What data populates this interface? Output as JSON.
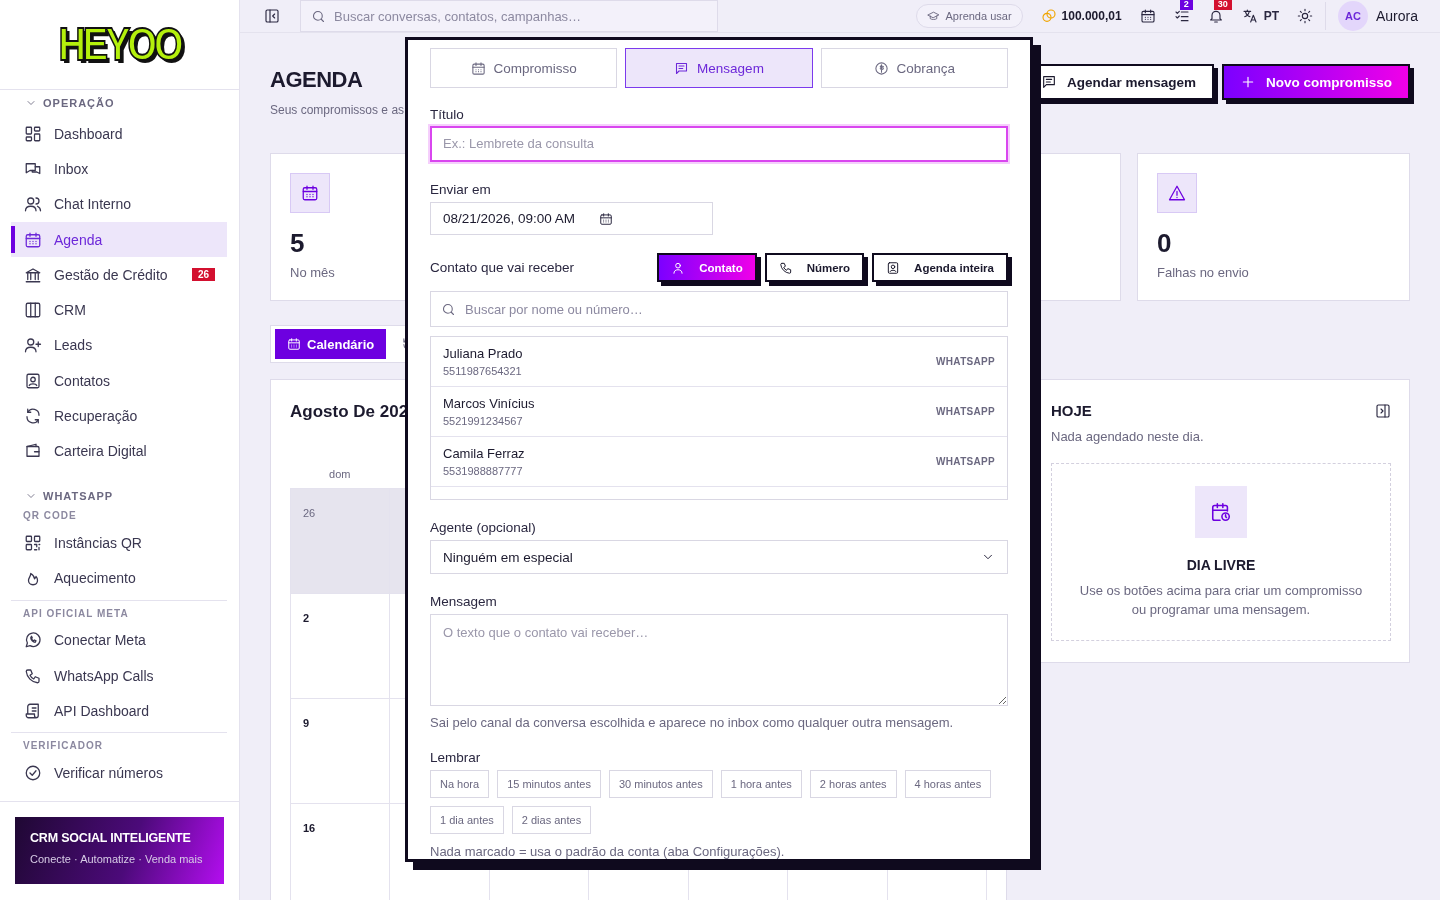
{
  "sidebar": {
    "logo": "HEYOO",
    "groups": [
      {
        "kind": "section",
        "title": "OPERAÇÃO",
        "expanded": true,
        "items": [
          {
            "label": "Dashboard",
            "selected": false
          },
          {
            "label": "Inbox",
            "selected": false
          },
          {
            "label": "Chat Interno",
            "selected": false
          },
          {
            "label": "Agenda",
            "selected": true
          },
          {
            "label": "Gestão de Crédito",
            "selected": false,
            "badge": "26"
          },
          {
            "label": "CRM",
            "selected": false
          },
          {
            "label": "Leads",
            "selected": false
          },
          {
            "label": "Contatos",
            "selected": false
          },
          {
            "label": "Recuperação",
            "selected": false
          },
          {
            "label": "Carteira Digital",
            "selected": false
          }
        ]
      },
      {
        "kind": "section",
        "title": "WHATSAPP",
        "expanded": true
      },
      {
        "kind": "subsection",
        "title": "QR CODE",
        "items": [
          {
            "label": "Instâncias QR",
            "selected": false
          },
          {
            "label": "Aquecimento",
            "selected": false
          }
        ]
      },
      {
        "kind": "subsection",
        "title": "API OFICIAL META",
        "items": [
          {
            "label": "Conectar Meta",
            "selected": false
          },
          {
            "label": "WhatsApp Calls",
            "selected": false
          },
          {
            "label": "API Dashboard",
            "selected": false
          }
        ]
      },
      {
        "kind": "subsection",
        "title": "VERIFICADOR",
        "items": [
          {
            "label": "Verificar números",
            "selected": false
          }
        ]
      }
    ],
    "promo": {
      "title": "CRM SOCIAL INTELIGENTE",
      "subtitle": "Conecte · Automatize · Venda mais"
    }
  },
  "topbar": {
    "search_placeholder": "Buscar conversas, contatos, campanhas…",
    "help_label": "Aprenda usar",
    "credits": "100.000,01",
    "tasks_badge": "2",
    "notifications_badge": "30",
    "language": "PT",
    "user": {
      "initials": "AC",
      "name": "Aurora"
    }
  },
  "page": {
    "title": "AGENDA",
    "subtitle": "Seus compromissos e as",
    "actions": [
      {
        "label": "Agendar mensagem",
        "kind": "secondary"
      },
      {
        "label": "Novo compromisso",
        "kind": "primary"
      }
    ]
  },
  "stats": [
    {
      "value": "5",
      "label": "No mês"
    },
    {
      "value": "0",
      "label": "Falhas no envio"
    }
  ],
  "view_tabs": [
    {
      "label": "Calendário",
      "selected": true
    }
  ],
  "calendar": {
    "title": "Agosto De 202",
    "weekdays": [
      "dom"
    ],
    "weeks": [
      {
        "day": "26",
        "outside": true
      },
      {
        "day": "2",
        "outside": false
      },
      {
        "day": "9",
        "outside": false
      },
      {
        "day": "16",
        "outside": false
      }
    ]
  },
  "today_panel": {
    "title": "HOJE",
    "subtitle": "Nada agendado neste dia.",
    "empty_title": "DIA LIVRE",
    "empty_text": "Use os botões acima para criar um compromisso ou programar uma mensagem."
  },
  "modal": {
    "types": [
      {
        "label": "Compromisso",
        "selected": false
      },
      {
        "label": "Mensagem",
        "selected": true
      },
      {
        "label": "Cobrança",
        "selected": false
      }
    ],
    "title_field": {
      "label": "Título",
      "placeholder": "Ex.: Lembrete da consulta"
    },
    "send_at": {
      "label": "Enviar em",
      "value": "08/21/2026, 09:00 AM"
    },
    "recipient": {
      "label": "Contato que vai receber",
      "modes": [
        {
          "label": "Contato",
          "selected": true
        },
        {
          "label": "Número",
          "selected": false
        },
        {
          "label": "Agenda inteira",
          "selected": false
        }
      ],
      "search_placeholder": "Buscar por nome ou número…",
      "contacts": [
        {
          "name": "Juliana Prado",
          "phone": "5511987654321",
          "channel": "WHATSAPP"
        },
        {
          "name": "Marcos Vinícius",
          "phone": "5521991234567",
          "channel": "WHATSAPP"
        },
        {
          "name": "Camila Ferraz",
          "phone": "5531988887777",
          "channel": "WHATSAPP"
        }
      ]
    },
    "agent": {
      "label": "Agente (opcional)",
      "value": "Ninguém em especial"
    },
    "message": {
      "label": "Mensagem",
      "placeholder": "O texto que o contato vai receber…",
      "hint": "Sai pelo canal da conversa escolhida e aparece no inbox como qualquer outra mensagem."
    },
    "remind": {
      "label": "Lembrar",
      "options": [
        {
          "label": "Na hora",
          "selected": false
        },
        {
          "label": "15 minutos antes",
          "selected": false
        },
        {
          "label": "30 minutos antes",
          "selected": false
        },
        {
          "label": "1 hora antes",
          "selected": false
        },
        {
          "label": "2 horas antes",
          "selected": false
        },
        {
          "label": "4 horas antes",
          "selected": false
        },
        {
          "label": "1 dia antes",
          "selected": false
        },
        {
          "label": "2 dias antes",
          "selected": false
        }
      ],
      "note": "Nada marcado = usa o padrão da conta (aba Configurações)."
    }
  }
}
